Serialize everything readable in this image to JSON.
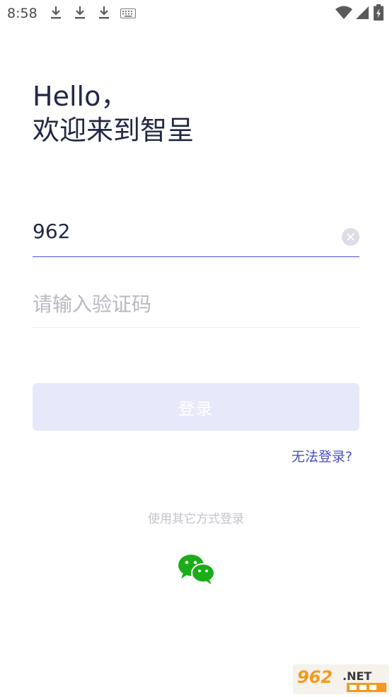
{
  "status_bar": {
    "time": "8:58",
    "icons": [
      "download-icon",
      "download-icon",
      "download-icon",
      "keyboard-icon",
      "wifi-icon",
      "signal-icon",
      "battery-icon"
    ]
  },
  "greeting": {
    "line1": "Hello，",
    "line2": "欢迎来到智呈"
  },
  "phone": {
    "value": "962"
  },
  "code": {
    "placeholder": "请输入验证码"
  },
  "login": {
    "label": "登录"
  },
  "links": {
    "cannot_login": "无法登录?"
  },
  "other_login": {
    "label": "使用其它方式登录",
    "methods": [
      "wechat-icon"
    ]
  },
  "colors": {
    "text_primary": "#222845",
    "accent": "#4a4fc6",
    "button_disabled_bg": "#e8e8fb",
    "wechat_green": "#1aad19"
  }
}
